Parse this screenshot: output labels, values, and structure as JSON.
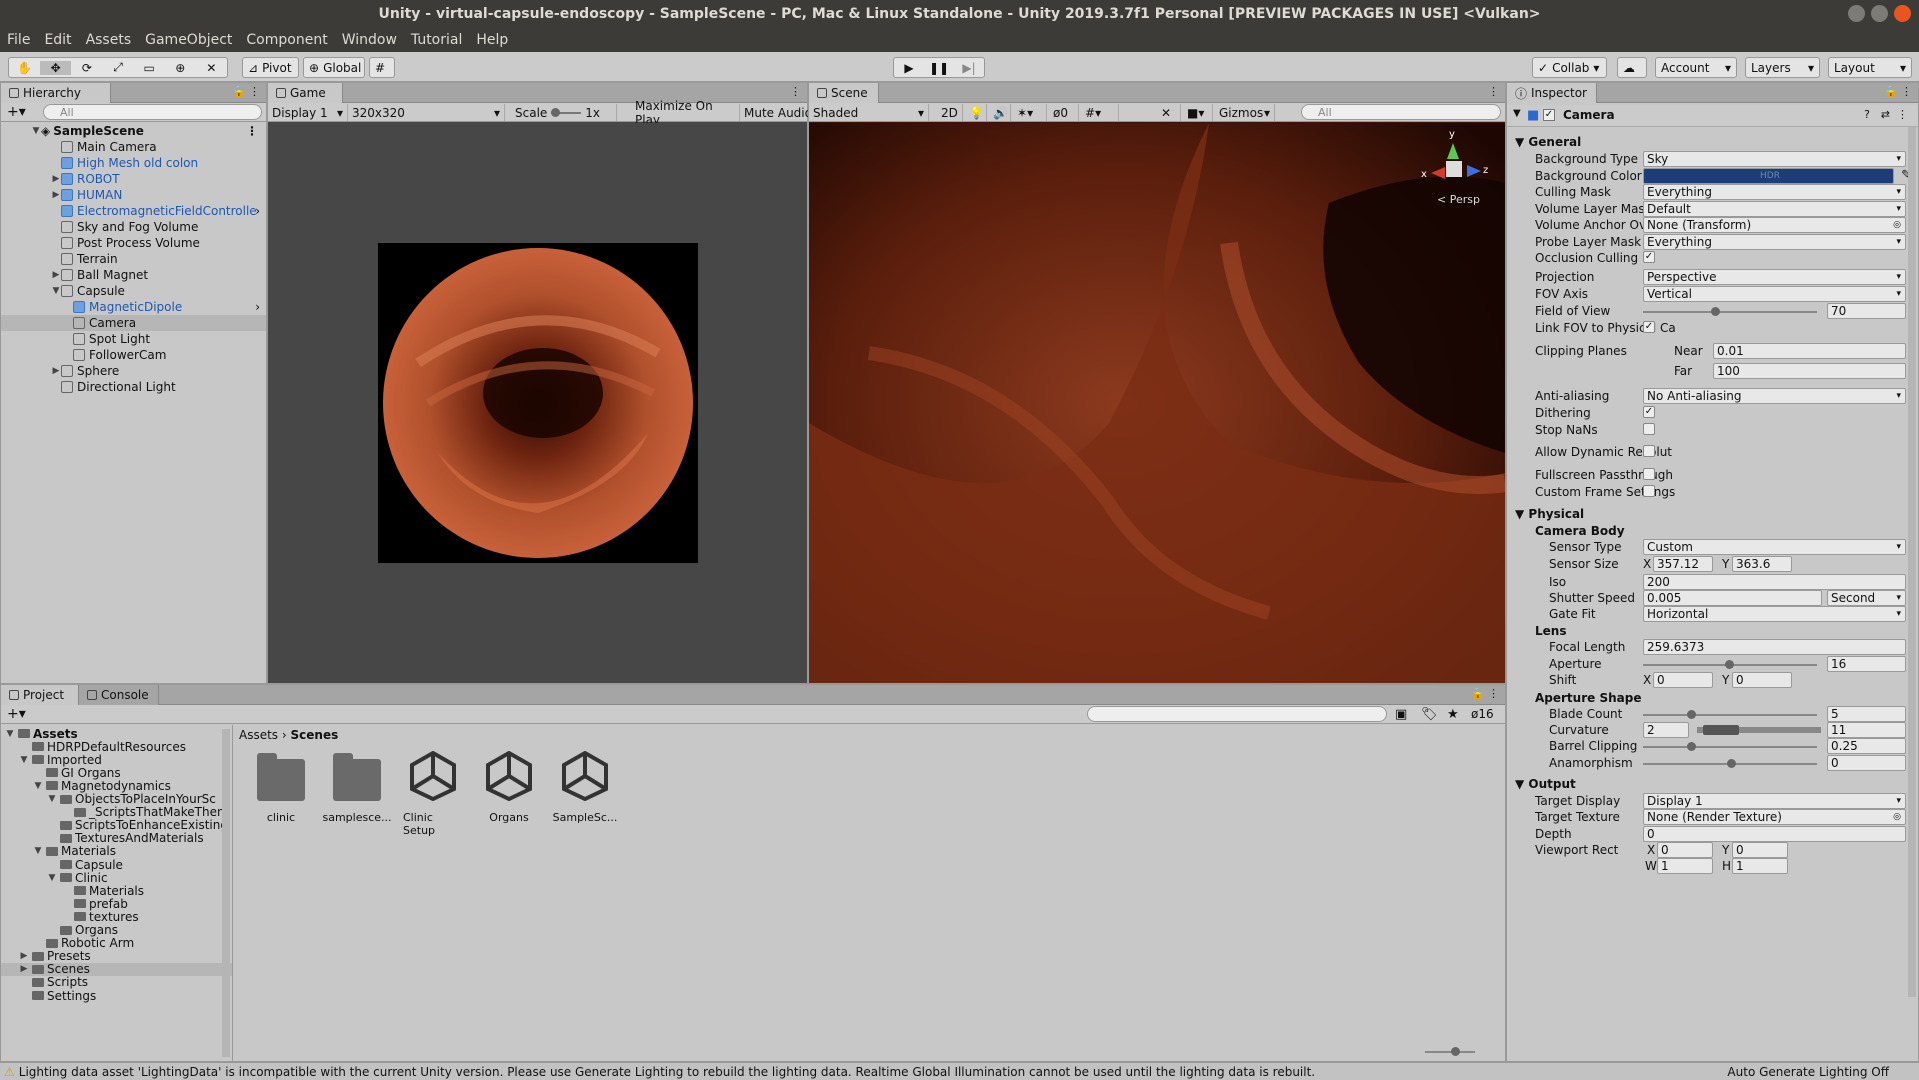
{
  "window": {
    "title": "Unity - virtual-capsule-endoscopy - SampleScene - PC, Mac & Linux Standalone - Unity 2019.3.7f1 Personal [PREVIEW PACKAGES IN USE] <Vulkan>"
  },
  "menu": [
    "File",
    "Edit",
    "Assets",
    "GameObject",
    "Component",
    "Window",
    "Tutorial",
    "Help"
  ],
  "toolbar": {
    "pivot": "Pivot",
    "global": "Global",
    "collab": "Collab",
    "account": "Account",
    "layers": "Layers",
    "layout": "Layout"
  },
  "hierarchy": {
    "tab": "Hierarchy",
    "search_placeholder": "All",
    "scene": "SampleScene",
    "items": [
      {
        "label": "Main Camera",
        "indent": 1,
        "blue": false,
        "arrow": ""
      },
      {
        "label": "High Mesh old colon",
        "indent": 1,
        "blue": true,
        "arrow": ""
      },
      {
        "label": "ROBOT",
        "indent": 1,
        "blue": true,
        "arrow": "▶"
      },
      {
        "label": "HUMAN",
        "indent": 1,
        "blue": true,
        "arrow": "▶"
      },
      {
        "label": "ElectromagneticFieldControlle",
        "indent": 1,
        "blue": true,
        "arrow": "",
        "more": "›"
      },
      {
        "label": "Sky and Fog Volume",
        "indent": 1,
        "blue": false,
        "arrow": ""
      },
      {
        "label": "Post Process Volume",
        "indent": 1,
        "blue": false,
        "arrow": ""
      },
      {
        "label": "Terrain",
        "indent": 1,
        "blue": false,
        "arrow": ""
      },
      {
        "label": "Ball Magnet",
        "indent": 1,
        "blue": false,
        "arrow": "▶"
      },
      {
        "label": "Capsule",
        "indent": 1,
        "blue": false,
        "arrow": "▼"
      },
      {
        "label": "MagneticDipole",
        "indent": 2,
        "blue": true,
        "arrow": "",
        "more": "›"
      },
      {
        "label": "Camera",
        "indent": 2,
        "blue": false,
        "arrow": "",
        "selected": true
      },
      {
        "label": "Spot Light",
        "indent": 2,
        "blue": false,
        "arrow": ""
      },
      {
        "label": "FollowerCam",
        "indent": 2,
        "blue": false,
        "arrow": ""
      },
      {
        "label": "Sphere",
        "indent": 1,
        "blue": false,
        "arrow": "▶"
      },
      {
        "label": "Directional Light",
        "indent": 1,
        "blue": false,
        "arrow": ""
      }
    ]
  },
  "game": {
    "tab": "Game",
    "display": "Display 1",
    "resolution": "320x320",
    "scale_label": "Scale",
    "scale_value": "1x",
    "maximize": "Maximize On Play",
    "mute": "Mute Audio"
  },
  "scene": {
    "tab": "Scene",
    "shading": "Shaded",
    "mode2d": "2D",
    "hidden_count": "0",
    "gizmos": "Gizmos",
    "search_placeholder": "All",
    "persp": "< Persp",
    "axis_y": "y",
    "axis_x": "x",
    "axis_z": "z"
  },
  "inspector": {
    "tab": "Inspector",
    "component": "Camera",
    "general": "General",
    "fields": [
      {
        "label": "Background Type",
        "value": "Sky",
        "type": "dropdown"
      },
      {
        "label": "Background Color",
        "value": "HDR",
        "type": "color"
      },
      {
        "label": "Culling Mask",
        "value": "Everything",
        "type": "dropdown"
      },
      {
        "label": "Volume Layer Mask",
        "value": "Default",
        "type": "dropdown"
      },
      {
        "label": "Volume Anchor Overrid",
        "value": "None (Transform)",
        "type": "object"
      },
      {
        "label": "Probe Layer Mask",
        "value": "Everything",
        "type": "dropdown"
      },
      {
        "label": "Occlusion Culling",
        "value": "✓",
        "type": "check"
      }
    ],
    "projection": {
      "label": "Projection",
      "value": "Perspective"
    },
    "fov_axis": {
      "label": "FOV Axis",
      "value": "Vertical"
    },
    "fov": {
      "label": "Field of View",
      "value": "70"
    },
    "link_fov": {
      "label": "Link FOV to Physical Ca",
      "value": "✓"
    },
    "clipping": {
      "label": "Clipping Planes",
      "near_label": "Near",
      "near": "0.01",
      "far_label": "Far",
      "far": "100"
    },
    "aa": {
      "label": "Anti-aliasing",
      "value": "No Anti-aliasing"
    },
    "dithering": {
      "label": "Dithering",
      "value": "✓"
    },
    "stopnans": {
      "label": "Stop NaNs",
      "value": ""
    },
    "dynres": {
      "label": "Allow Dynamic Resolut",
      "value": ""
    },
    "passthrough": {
      "label": "Fullscreen Passthrough",
      "value": ""
    },
    "customframe": {
      "label": "Custom Frame Settings",
      "value": ""
    },
    "physical": "Physical",
    "camera_body": "Camera Body",
    "sensor_type": {
      "label": "Sensor Type",
      "value": "Custom"
    },
    "sensor_size": {
      "label": "Sensor Size",
      "x_label": "X",
      "x": "357.12",
      "y_label": "Y",
      "y": "363.6"
    },
    "iso": {
      "label": "Iso",
      "value": "200"
    },
    "shutter": {
      "label": "Shutter Speed",
      "value": "0.005",
      "unit": "Second"
    },
    "gatefit": {
      "label": "Gate Fit",
      "value": "Horizontal"
    },
    "lens": "Lens",
    "focal": {
      "label": "Focal Length",
      "value": "259.6373"
    },
    "aperture": {
      "label": "Aperture",
      "value": "16"
    },
    "shift": {
      "label": "Shift",
      "x_label": "X",
      "x": "0",
      "y_label": "Y",
      "y": "0"
    },
    "aperture_shape": "Aperture Shape",
    "blade": {
      "label": "Blade Count",
      "value": "5"
    },
    "curvature": {
      "label": "Curvature",
      "min": "2",
      "max": "11"
    },
    "barrel": {
      "label": "Barrel Clipping",
      "value": "0.25"
    },
    "anamorph": {
      "label": "Anamorphism",
      "value": "0"
    },
    "output": "Output",
    "target_display": {
      "label": "Target Display",
      "value": "Display 1"
    },
    "target_texture": {
      "label": "Target Texture",
      "value": "None (Render Texture)"
    },
    "depth": {
      "label": "Depth",
      "value": "0"
    },
    "viewport": {
      "label": "Viewport Rect",
      "x_label": "X",
      "x": "0",
      "y_label": "Y",
      "y": "0",
      "w_label": "W",
      "w": "1",
      "h_label": "H",
      "h": "1"
    }
  },
  "project": {
    "tab": "Project",
    "console_tab": "Console",
    "hidden_count": "16",
    "tree": [
      {
        "label": "Assets",
        "indent": 0,
        "arrow": "▼",
        "bold": true
      },
      {
        "label": "HDRPDefaultResources",
        "indent": 1,
        "arrow": ""
      },
      {
        "label": "Imported",
        "indent": 1,
        "arrow": "▼"
      },
      {
        "label": "GI Organs",
        "indent": 2,
        "arrow": ""
      },
      {
        "label": "Magnetodynamics",
        "indent": 2,
        "arrow": "▼"
      },
      {
        "label": "ObjectsToPlaceInYourSc",
        "indent": 3,
        "arrow": "▼"
      },
      {
        "label": "_ScriptsThatMakeThen",
        "indent": 4,
        "arrow": ""
      },
      {
        "label": "ScriptsToEnhanceExisting",
        "indent": 3,
        "arrow": ""
      },
      {
        "label": "TexturesAndMaterials",
        "indent": 3,
        "arrow": ""
      },
      {
        "label": "Materials",
        "indent": 2,
        "arrow": "▼"
      },
      {
        "label": "Capsule",
        "indent": 3,
        "arrow": ""
      },
      {
        "label": "Clinic",
        "indent": 3,
        "arrow": "▼"
      },
      {
        "label": "Materials",
        "indent": 4,
        "arrow": ""
      },
      {
        "label": "prefab",
        "indent": 4,
        "arrow": ""
      },
      {
        "label": "textures",
        "indent": 4,
        "arrow": ""
      },
      {
        "label": "Organs",
        "indent": 3,
        "arrow": ""
      },
      {
        "label": "Robotic Arm",
        "indent": 2,
        "arrow": ""
      },
      {
        "label": "Presets",
        "indent": 1,
        "arrow": "▶"
      },
      {
        "label": "Scenes",
        "indent": 1,
        "arrow": "▶",
        "selected": true
      },
      {
        "label": "Scripts",
        "indent": 1,
        "arrow": ""
      },
      {
        "label": "Settings",
        "indent": 1,
        "arrow": ""
      }
    ],
    "breadcrumb": [
      "Assets",
      "Scenes"
    ],
    "assets": [
      {
        "label": "clinic",
        "kind": "folder"
      },
      {
        "label": "samplesce...",
        "kind": "folder"
      },
      {
        "label": "Clinic Setup",
        "kind": "unity"
      },
      {
        "label": "Organs",
        "kind": "unity"
      },
      {
        "label": "SampleSc...",
        "kind": "unity"
      }
    ]
  },
  "status": {
    "message": "Lighting data asset 'LightingData' is incompatible with the current Unity version. Please use Generate Lighting to rebuild the lighting data.  Realtime Global Illumination cannot be used until the lighting data is rebuilt.",
    "right": "Auto Generate Lighting Off"
  }
}
